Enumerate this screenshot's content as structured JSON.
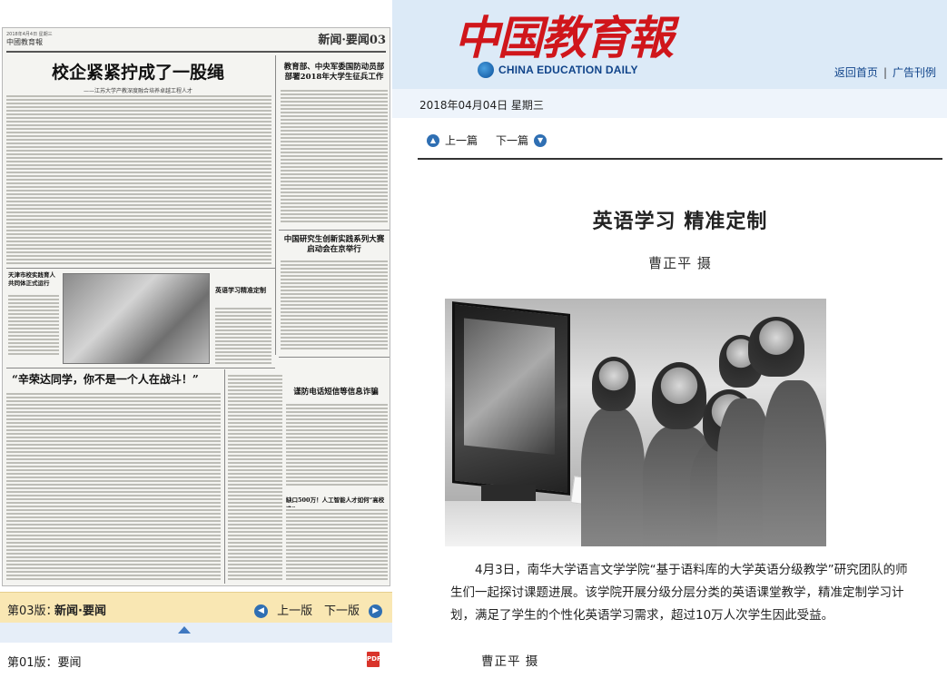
{
  "newspaper_page": {
    "top_line": "2018年4月4日 星期三",
    "masthead": "中國教育報",
    "section_tag": "新闻·要闻03",
    "main_headline": "校企紧紧拧成了一股绳",
    "main_subhead": "——江苏大学产教深度融合培养卓越工程人才",
    "headline_2": "教育部、中央军委国防动员部部署2018年大学生征兵工作",
    "headline_3": "中国研究生创新实践系列大赛启动会在京举行",
    "headline_4": "天津市校实践育人共同体正式运行",
    "photo_caption_small": "英语学习精准定制",
    "headline_5": "“辛荣达同学，你不是一个人在战斗！”",
    "headline_6": "谨防电话短信等信息诈骗",
    "headline_7": "缺口500万！人工智能人才如何“高校造”"
  },
  "left_bar": {
    "edition_label": "第03版：",
    "edition_name": "新闻·要闻",
    "prev_label": "上一版",
    "next_label": "下一版",
    "current_edition_label": "第01版：要闻",
    "pdf_icon_text": "PDF"
  },
  "header": {
    "logo_cn": "中国教育報",
    "logo_en": "CHINA EDUCATION DAILY",
    "links": [
      "返回首页",
      "广告刊例"
    ],
    "link_sep": "|"
  },
  "date": "2018年04月04日  星期三",
  "article": {
    "prev_label": "上一篇",
    "next_label": "下一篇",
    "title": "英语学习  精准定制",
    "byline": "曹正平  摄",
    "caption": "4月3日，南华大学语言文学学院“基于语料库的大学英语分级教学”研究团队的师生们一起探讨课题进展。该学院开展分级分层分类的英语课堂教学，精准定制学习计划，满足了学生的个性化英语学习需求，超过10万人次学生因此受益。",
    "credit": "曹正平  摄"
  }
}
